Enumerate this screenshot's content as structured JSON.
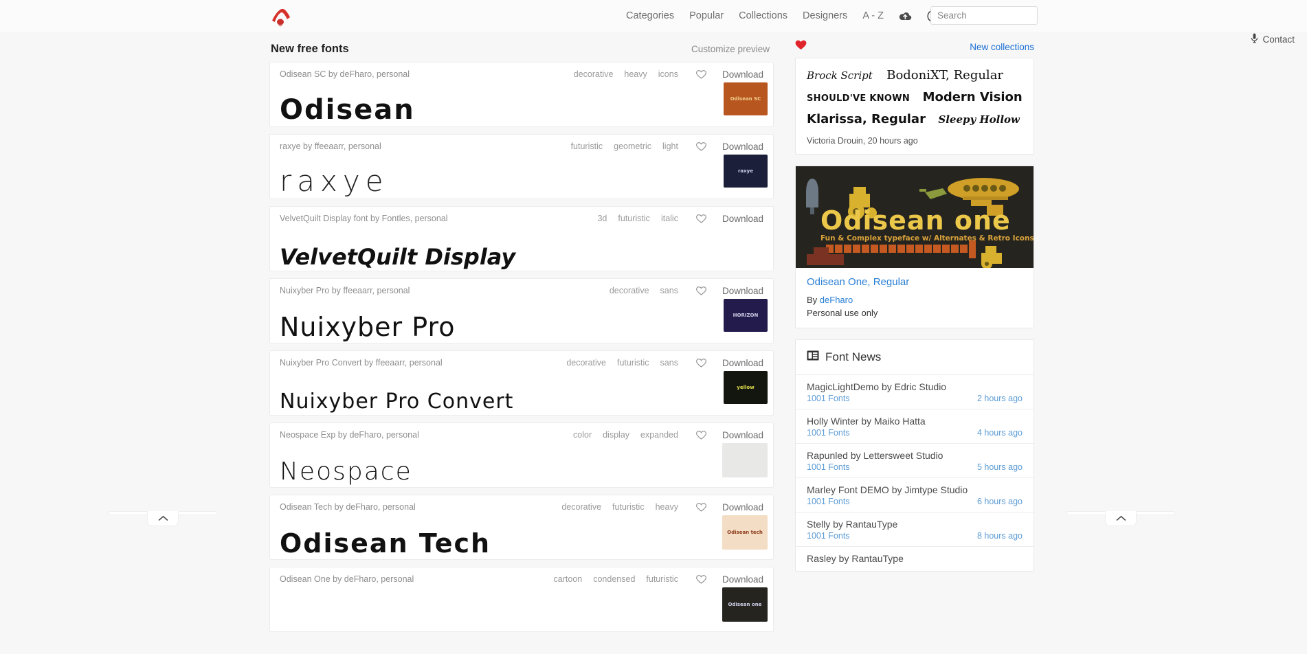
{
  "nav": {
    "items": [
      {
        "label": "Categories",
        "name": "nav-categories"
      },
      {
        "label": "Popular",
        "name": "nav-popular"
      },
      {
        "label": "Collections",
        "name": "nav-collections"
      },
      {
        "label": "Designers",
        "name": "nav-designers"
      },
      {
        "label": "A - Z",
        "name": "nav-a-z"
      }
    ],
    "upload_icon": "cloud-upload-icon",
    "account_icon": "account-circle-icon",
    "logo_icon": "site-logo-icon"
  },
  "search": {
    "placeholder": "Search",
    "value": ""
  },
  "contact": {
    "label": "Contact",
    "icon": "microphone-icon"
  },
  "main": {
    "section_title": "New free fonts",
    "customize_label": "Customize preview",
    "download_label": "Download",
    "heart_icon": "heart-outline-icon",
    "rows": [
      {
        "title": "Odisean SC by deFharo, personal",
        "preview": "Odisean",
        "tags": [
          "decorative",
          "heavy",
          "icons"
        ],
        "thumb_bg": "#b8561f",
        "thumb_label": "Odisean SC"
      },
      {
        "title": "raxye by ffeeaarr, personal",
        "preview": "raxye",
        "tags": [
          "futuristic",
          "geometric",
          "light"
        ],
        "thumb_bg": "#1b1f3a",
        "thumb_label": "raxye"
      },
      {
        "title": "VelvetQuilt Display font by Fontles, personal",
        "preview": "VelvetQuilt Display",
        "tags": [
          "3d",
          "futuristic",
          "italic"
        ],
        "thumb_bg": "",
        "thumb_label": ""
      },
      {
        "title": "Nuixyber Pro by ffeeaarr, personal",
        "preview": "Nuixyber Pro",
        "tags": [
          "decorative",
          "sans"
        ],
        "thumb_bg": "#241b4d",
        "thumb_label": "HORIZON"
      },
      {
        "title": "Nuixyber Pro Convert by ffeeaarr, personal",
        "preview": "Nuixyber Pro Convert",
        "tags": [
          "decorative",
          "futuristic",
          "sans"
        ],
        "thumb_bg": "#13150f",
        "thumb_label": "yellow"
      },
      {
        "title": "Neospace Exp by deFharo, personal",
        "preview": "Neospace",
        "tags": [
          "color",
          "display",
          "expanded"
        ],
        "thumb_bg": "#e8e8e6",
        "thumb_label": ""
      },
      {
        "title": "Odisean Tech by deFharo, personal",
        "preview": "Odisean Tech",
        "tags": [
          "decorative",
          "futuristic",
          "heavy"
        ],
        "thumb_bg": "#f3ddc4",
        "thumb_label": "Odisean tech"
      },
      {
        "title": "Odisean One by deFharo, personal",
        "preview": "",
        "tags": [
          "cartoon",
          "condensed",
          "futuristic"
        ],
        "thumb_bg": "#26241f",
        "thumb_label": "Odisean one"
      }
    ]
  },
  "sidebar": {
    "heart_icon": "heart-filled-icon",
    "new_collections_label": "New collections",
    "collection": {
      "samples": [
        {
          "a": "Brock Script",
          "b": "BodoniXT, Regular"
        },
        {
          "a": "SHOULD'VE KNOWN",
          "b": "Modern Vision"
        },
        {
          "a": "Klarissa,  Regular",
          "b": "Sleepy Hollow"
        }
      ],
      "credit": "Victoria Drouin, 20 hours ago"
    },
    "promo": {
      "banner_title": "Odisean one",
      "banner_sub": "Fun & Complex typeface w/ Alternates & Retro Icons",
      "banner_alpha": "abcdefghijklmnopqrstuvwxyz",
      "title": "Odisean One, Regular",
      "by_prefix": "By ",
      "by_author": "deFharo",
      "license": "Personal use only"
    },
    "news": {
      "icon": "news-list-icon",
      "title": "Font News",
      "items": [
        {
          "title": "MagicLightDemo by Edric Studio",
          "source": "1001 Fonts",
          "time": "2 hours ago"
        },
        {
          "title": "Holly Winter by Maiko Hatta",
          "source": "1001 Fonts",
          "time": "4 hours ago"
        },
        {
          "title": "Rapunled by Lettersweet Studio",
          "source": "1001 Fonts",
          "time": "5 hours ago"
        },
        {
          "title": "Marley Font DEMO by Jimtype Studio",
          "source": "1001 Fonts",
          "time": "6 hours ago"
        },
        {
          "title": "Stelly by RantauType",
          "source": "1001 Fonts",
          "time": "8 hours ago"
        },
        {
          "title": "Rasley by RantauType",
          "source": "",
          "time": ""
        }
      ]
    }
  },
  "handles": {
    "left_icon": "chevron-up-icon",
    "right_icon": "chevron-up-icon"
  },
  "colors": {
    "brand_red": "#d6312b",
    "link_blue": "#2a7fd4",
    "news_blue": "#5b9bd5",
    "page_bg": "#f7f7f7"
  }
}
